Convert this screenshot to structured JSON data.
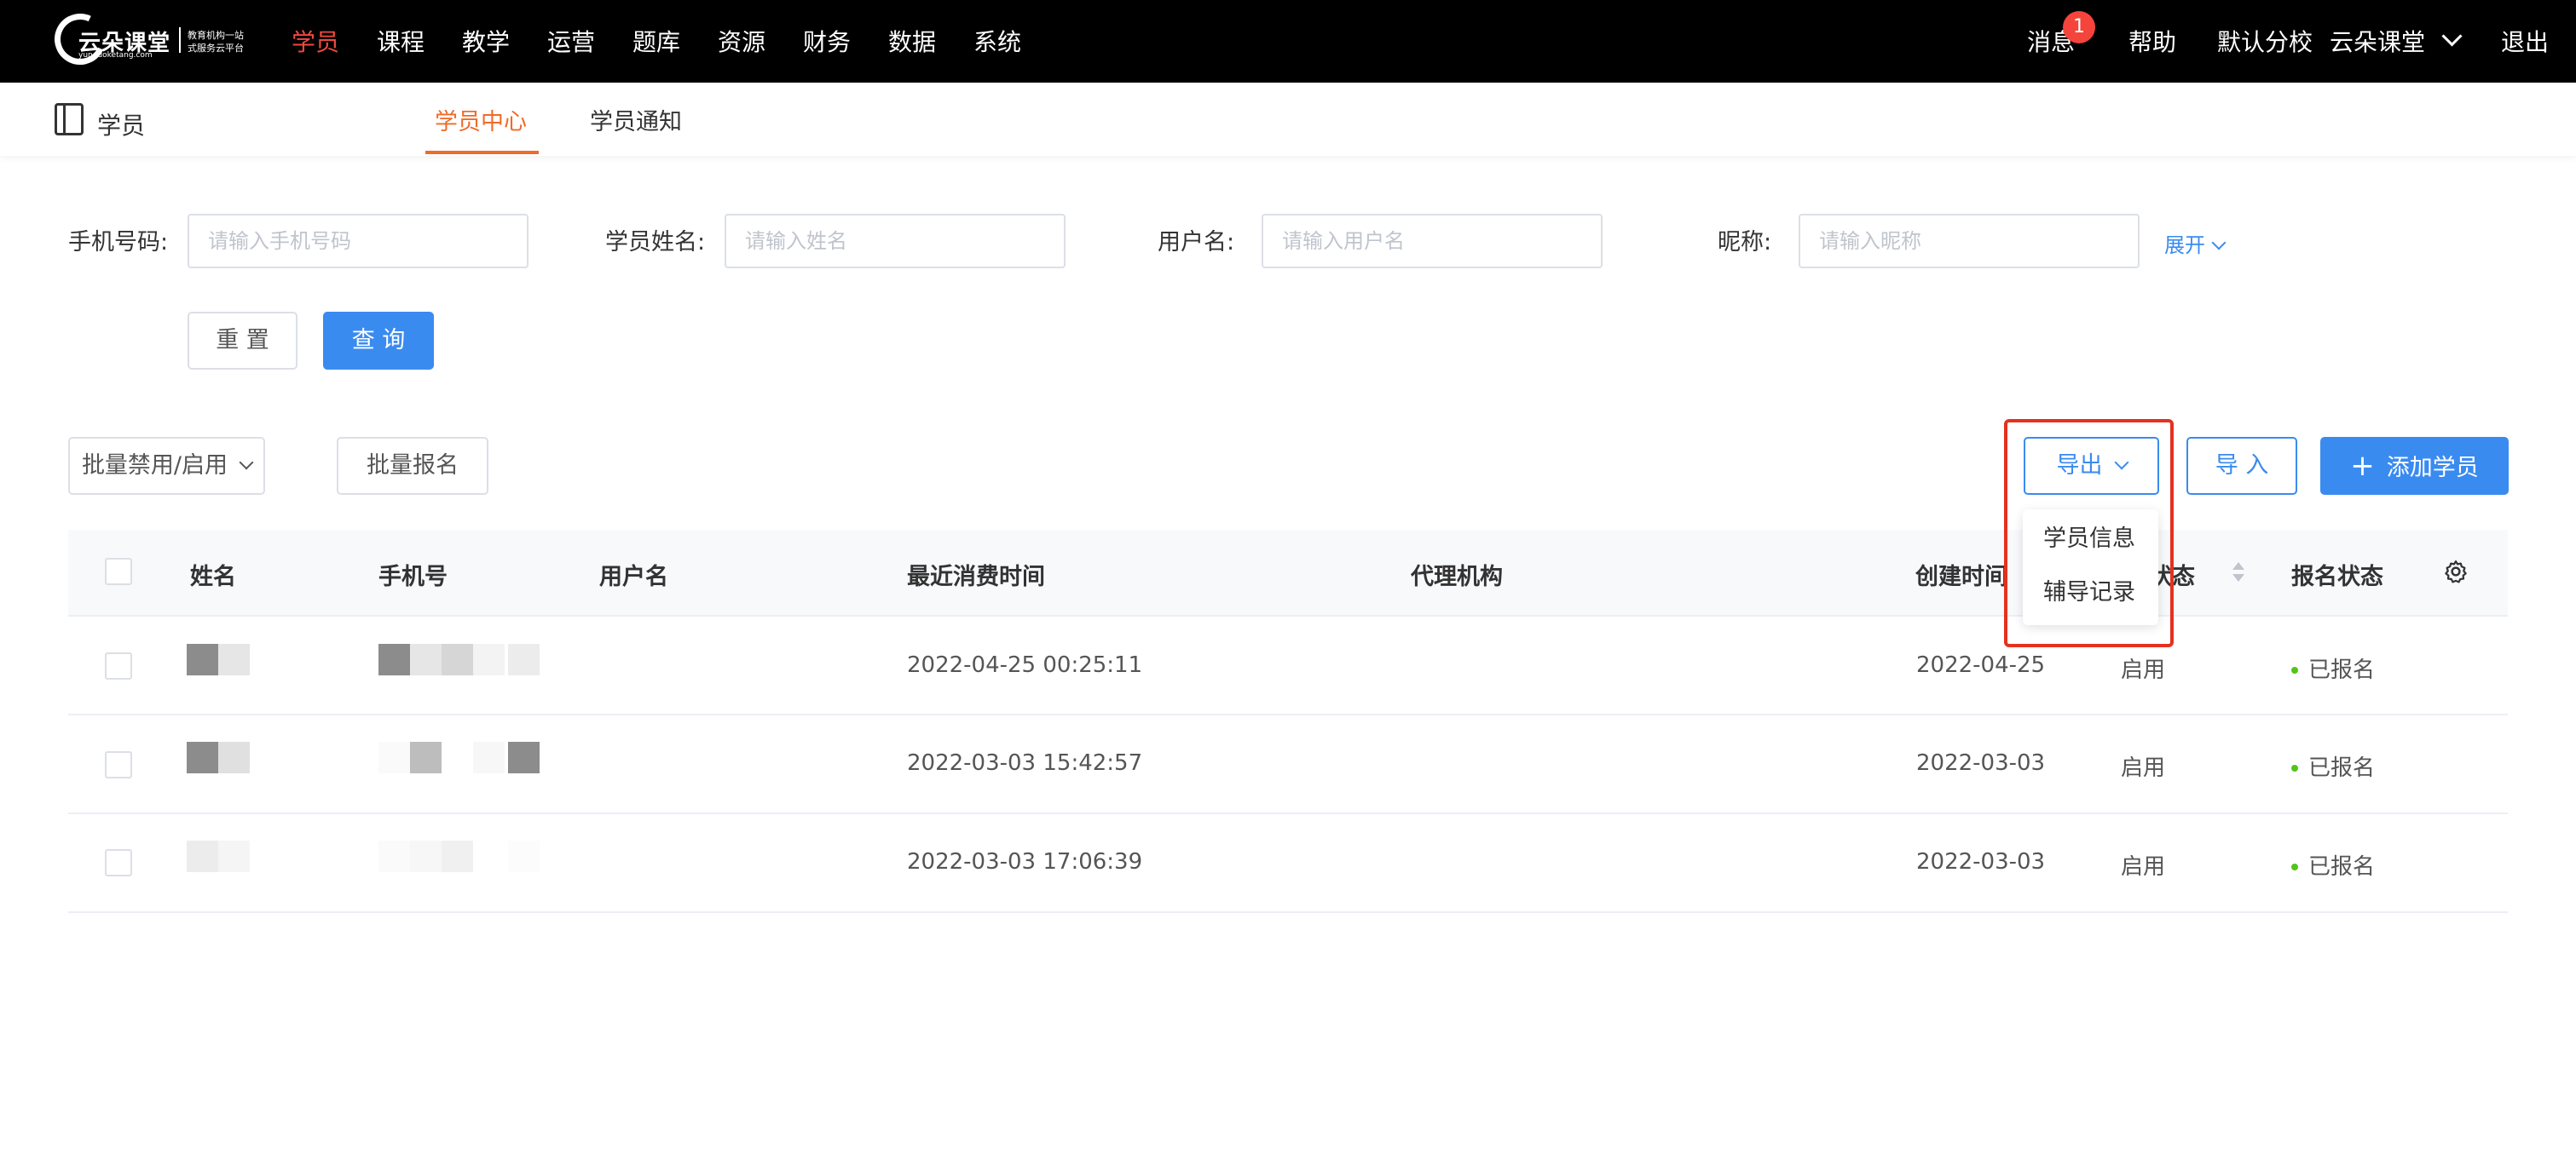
{
  "logo": {
    "name": "云朵课堂",
    "domain": "yunduoketang.com",
    "slogan_line1": "教育机构一站",
    "slogan_line2": "式服务云平台"
  },
  "nav": {
    "items": [
      "学员",
      "课程",
      "教学",
      "运营",
      "题库",
      "资源",
      "财务",
      "数据",
      "系统"
    ],
    "active": "学员",
    "right": {
      "messages": "消息",
      "message_count": "1",
      "help": "帮助",
      "branch": "默认分校",
      "account": "云朵课堂",
      "logout": "退出"
    }
  },
  "subnav": {
    "title": "学员",
    "tabs": [
      "学员中心",
      "学员通知"
    ],
    "active_tab": "学员中心"
  },
  "filters": {
    "phone": {
      "label": "手机号码:",
      "placeholder": "请输入手机号码"
    },
    "name": {
      "label": "学员姓名:",
      "placeholder": "请输入姓名"
    },
    "username": {
      "label": "用户名:",
      "placeholder": "请输入用户名"
    },
    "nickname": {
      "label": "昵称:",
      "placeholder": "请输入昵称"
    },
    "expand": "展开",
    "reset": "重 置",
    "query": "查 询"
  },
  "actions": {
    "batch_toggle": "批量禁用/启用",
    "batch_enroll": "批量报名",
    "export": "导出",
    "import": "导 入",
    "add_student": "添加学员",
    "export_menu": [
      "学员信息",
      "辅导记录"
    ]
  },
  "table": {
    "headers": {
      "name": "姓名",
      "phone": "手机号",
      "username": "用户名",
      "last_consume": "最近消费时间",
      "agency": "代理机构",
      "created": "创建时间",
      "account_status_visible": "号状态",
      "enroll_status": "报名状态"
    },
    "rows": [
      {
        "last_consume": "2022-04-25 00:25:11",
        "created": "2022-04-25",
        "status": "启用",
        "enroll": "已报名"
      },
      {
        "last_consume": "2022-03-03 15:42:57",
        "created": "2022-03-03",
        "status": "启用",
        "enroll": "已报名"
      },
      {
        "last_consume": "2022-03-03 17:06:39",
        "created": "2022-03-03",
        "status": "启用",
        "enroll": "已报名"
      }
    ]
  },
  "colors": {
    "topbar": "#000000",
    "nav_active": "#f04a3e",
    "tab_active": "#ef6b2a",
    "primary": "#3a8bf0",
    "highlight_box": "#e5311f",
    "enrolled_dot": "#52c41a"
  }
}
